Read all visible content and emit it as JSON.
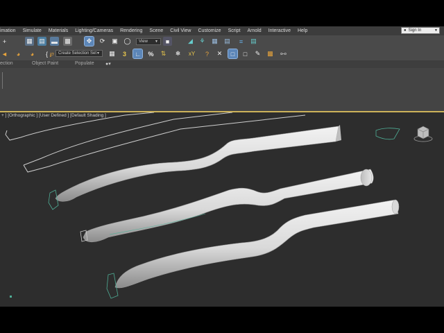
{
  "menu": {
    "items": [
      "imation",
      "Simulate",
      "Materials",
      "Lighting/Cameras",
      "Rendering",
      "Scene",
      "Civil View",
      "Customize",
      "Script",
      "Arnold",
      "Interactive",
      "Help"
    ],
    "signin_label": "Sign In"
  },
  "toolbar": {
    "selection_set_placeholder": "Create Selection Set",
    "reference_coord": "View"
  },
  "ribbon": {
    "tabs": [
      "ection",
      "Object Paint",
      "Populate"
    ]
  },
  "viewport": {
    "label": "+ ] [Orthographic ] [User Defined ] [Default Shading ]"
  },
  "colors": {
    "viewport_border": "#cdb35a",
    "selected_tool": "#5c86b8",
    "object_fill": "#dcdcdc",
    "shape_outline": "#cfcfcf",
    "gizmo_teal": "#4fae96"
  }
}
